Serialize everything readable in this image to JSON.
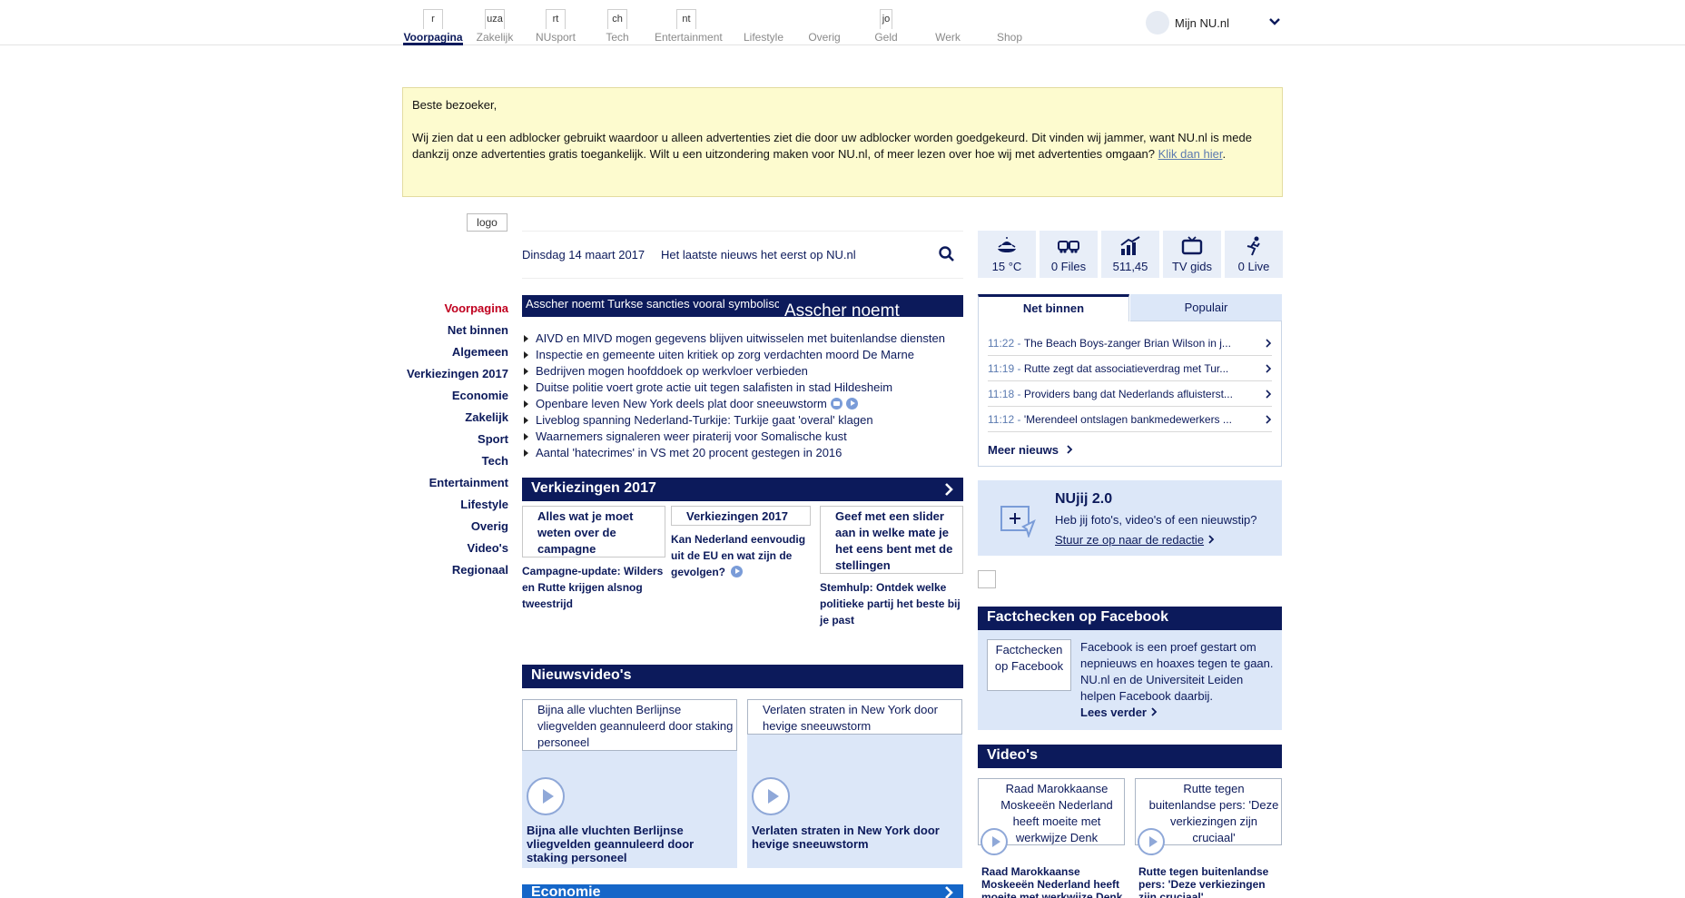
{
  "topnav": {
    "items": [
      {
        "icon_text": "r",
        "label": "Voorpagina",
        "active": true
      },
      {
        "icon_text": "uza",
        "label": "Zakelijk"
      },
      {
        "icon_text": "rt",
        "label": "NUsport"
      },
      {
        "icon_text": "ch",
        "label": "Tech"
      },
      {
        "icon_text": "nt",
        "label": "Entertainment"
      },
      {
        "icon_text": "",
        "label": "Lifestyle"
      },
      {
        "icon_text": "",
        "label": "Overig"
      },
      {
        "icon_text": "jo",
        "label": "Geld"
      },
      {
        "icon_text": "",
        "label": "Werk"
      },
      {
        "icon_text": "",
        "label": "Shop"
      }
    ],
    "account_label": "Mijn NU.nl"
  },
  "notice": {
    "greeting": "Beste bezoeker,",
    "body": "Wij zien dat u een adblocker gebruikt waardoor u alleen advertenties ziet die door uw adblocker worden goedgekeurd. Dit vinden wij jammer, want NU.nl is mede dankzij onze advertenties gratis toegankelijk. Wilt u een uitzondering maken voor NU.nl, of meer lezen over hoe wij met advertenties omgaan?",
    "link": "Klik dan hier",
    "end": "."
  },
  "logo_alt": "logo",
  "leftnav": [
    {
      "label": "Voorpagina",
      "active": true
    },
    {
      "label": "Net binnen"
    },
    {
      "label": "Algemeen"
    },
    {
      "label": "Verkiezingen 2017"
    },
    {
      "label": "Economie"
    },
    {
      "label": "Zakelijk"
    },
    {
      "label": "Sport"
    },
    {
      "label": "Tech"
    },
    {
      "label": "Entertainment"
    },
    {
      "label": "Lifestyle"
    },
    {
      "label": "Overig"
    },
    {
      "label": "Video's"
    },
    {
      "label": "Regionaal"
    }
  ],
  "datebar": {
    "date": "Dinsdag 14 maart 2017",
    "slogan": "Het laatste nieuws het eerst op NU.nl"
  },
  "hero": {
    "img1_alt": "Asscher noemt Turkse sancties vooral symbolisch",
    "img2_alt": "Asscher noemt"
  },
  "headlines": [
    {
      "text": "AIVD en MIVD mogen gegevens blijven uitwisselen met buitenlandse diensten"
    },
    {
      "text": "Inspectie en gemeente uiten kritiek op zorg verdachten moord De Marne"
    },
    {
      "text": "Bedrijven mogen hoofddoek op werkvloer verbieden"
    },
    {
      "text": "Duitse politie voert grote actie uit tegen salafisten in stad Hildesheim"
    },
    {
      "text": "Openbare leven New York deels plat door sneeuwstorm",
      "icons": [
        "camera",
        "play"
      ]
    },
    {
      "text": "Liveblog spanning Nederland-Turkije: Turkije gaat 'overal' klagen"
    },
    {
      "text": "Waarnemers signaleren weer piraterij voor Somalische kust"
    },
    {
      "text": "Aantal 'hatecrimes' in VS met 20 procent gestegen in 2016"
    }
  ],
  "verkiezingen": {
    "title": "Verkiezingen 2017",
    "cards": [
      {
        "img_alt": "Alles wat je moet weten over de campagne",
        "caption": "Campagne-update: Wilders en Rutte krijgen alsnog tweestrijd"
      },
      {
        "img_alt": "Verkiezingen 2017",
        "caption": "Kan Nederland eenvoudig uit de EU en wat zijn de gevolgen?",
        "video": true
      },
      {
        "img_alt": "Geef met een slider aan in welke mate je het eens bent met de stellingen",
        "caption": "Stemhulp: Ontdek welke politieke partij het beste bij je past"
      }
    ]
  },
  "nieuwsvideos": {
    "title": "Nieuwsvideo's",
    "cards": [
      {
        "img_alt": "Bijna alle vluchten Berlijnse vliegvelden geannuleerd door staking personeel",
        "caption": "Bijna alle vluchten Berlijnse vliegvelden geannuleerd door staking personeel"
      },
      {
        "img_alt": "Verlaten straten in New York door hevige sneeuwstorm",
        "caption": "Verlaten straten in New York door hevige sneeuwstorm"
      }
    ]
  },
  "economie": {
    "title": "Economie"
  },
  "widgets": [
    {
      "icon": "weather-icon",
      "value": "15 °C"
    },
    {
      "icon": "traffic-icon",
      "value": "0 Files"
    },
    {
      "icon": "stocks-icon",
      "value": "511,45"
    },
    {
      "icon": "tv-icon",
      "value": "TV gids"
    },
    {
      "icon": "live-sport-icon",
      "value": "0 Live"
    }
  ],
  "tabs": {
    "active": "Net binnen",
    "inactive": "Populair"
  },
  "netbinnen": [
    {
      "time": "11:22",
      "title": "The Beach Boys-zanger Brian Wilson in j..."
    },
    {
      "time": "11:19",
      "title": "Rutte zegt dat associatieverdrag met Tur..."
    },
    {
      "time": "11:18",
      "title": "Providers bang dat Nederlands afluisterst..."
    },
    {
      "time": "11:12",
      "title": "'Merendeel ontslagen bankmedewerkers ..."
    }
  ],
  "meer_nieuws": "Meer nieuws",
  "nujij": {
    "title": "NUjij 2.0",
    "text": "Heb jij foto's, video's of een nieuwstip?",
    "link": "Stuur ze op naar de redactie"
  },
  "factchecken": {
    "title": "Factchecken op Facebook",
    "img_alt": "Factchecken op Facebook",
    "text": "Facebook is een proef gestart om nepnieuws en hoaxes tegen te gaan. NU.nl en de Universiteit Leiden helpen Facebook daarbij.",
    "more": "Lees verder"
  },
  "videos": {
    "title": "Video's",
    "cards": [
      {
        "img_alt": "Raad Marokkaanse Moskeeën Nederland heeft moeite met werkwijze Denk",
        "caption": "Raad Marokkaanse Moskeeën Nederland heeft moeite met werkwijze Denk"
      },
      {
        "img_alt": "Rutte tegen buitenlandse pers: 'Deze verkiezingen zijn cruciaal'",
        "caption": "Rutte tegen buitenlandse pers: 'Deze verkiezingen zijn cruciaal'"
      }
    ]
  },
  "colors": {
    "brand": "#0c1a5b",
    "active_red": "#c0001f",
    "panel": "#dce7f8",
    "notice": "#fdfbcf",
    "economie": "#1566c8"
  }
}
